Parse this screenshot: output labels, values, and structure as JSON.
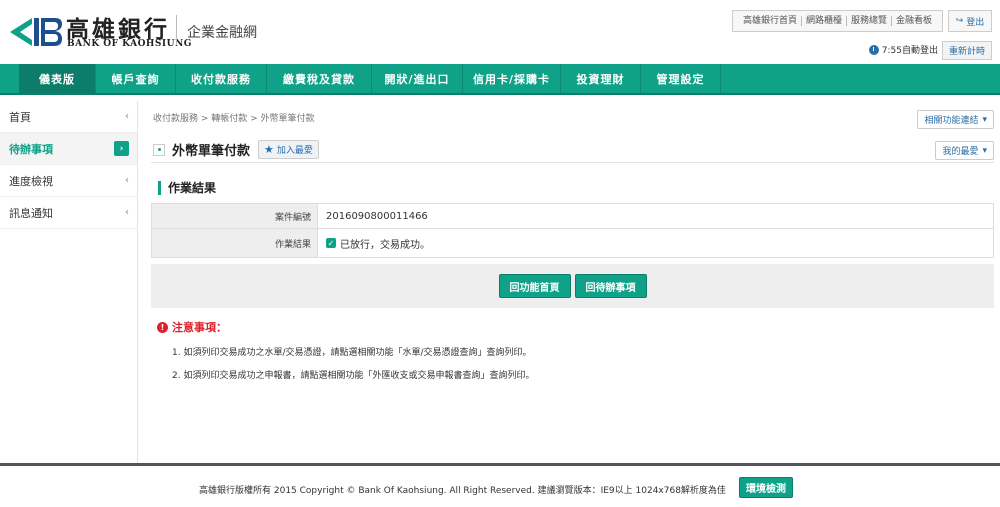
{
  "brand": {
    "name_cn": "高雄銀行",
    "name_en": "BANK OF KAOHSIUNG",
    "subtitle": "企業金融網"
  },
  "top_links": [
    "高雄銀行首頁",
    "網路櫃檯",
    "服務總覽",
    "金融看板"
  ],
  "logout_label": "登出",
  "session": {
    "time_text": "7:55自動登出",
    "reset_label": "重新計時"
  },
  "nav": [
    {
      "label": "儀表版",
      "active": true
    },
    {
      "label": "帳戶查詢"
    },
    {
      "label": "收付款服務"
    },
    {
      "label": "繳費稅及貸款"
    },
    {
      "label": "開狀/進出口"
    },
    {
      "label": "信用卡/採購卡"
    },
    {
      "label": "投資理財"
    },
    {
      "label": "管理設定"
    }
  ],
  "sidebar": [
    {
      "label": "首頁"
    },
    {
      "label": "待辦事項",
      "active": true
    },
    {
      "label": "進度檢視"
    },
    {
      "label": "訊息通知"
    }
  ],
  "breadcrumb": "收付款服務 > 轉帳付款 > 外幣單筆付款",
  "related_label": "相關功能連結",
  "favorite_label": "我的最愛",
  "page_title": "外幣單筆付款",
  "add_favorite_label": "加入最愛",
  "section_title": "作業結果",
  "result": {
    "case_no_label": "案件編號",
    "case_no": "2016090800011466",
    "status_label": "作業結果",
    "status_text": "已放行，交易成功。"
  },
  "buttons": {
    "back_home": "回功能首頁",
    "back_todo": "回待辦事項"
  },
  "notes": {
    "title": "注意事項：",
    "items": [
      "1. 如須列印交易成功之水單/交易憑證，請點選相關功能「水單/交易憑證查詢」查詢列印。",
      "2. 如須列印交易成功之申報書，請點選相關功能「外匯收支或交易申報書查詢」查詢列印。"
    ]
  },
  "footer": {
    "text": "高雄銀行版權所有 2015 Copyright © Bank Of Kaohsiung. All Right Reserved. 建議瀏覽版本：IE9以上 1024x768解析度為佳",
    "env_check": "環境檢測"
  },
  "colors": {
    "accent": "#10a289",
    "alert": "#d9232d",
    "link": "#2a6ea6"
  }
}
